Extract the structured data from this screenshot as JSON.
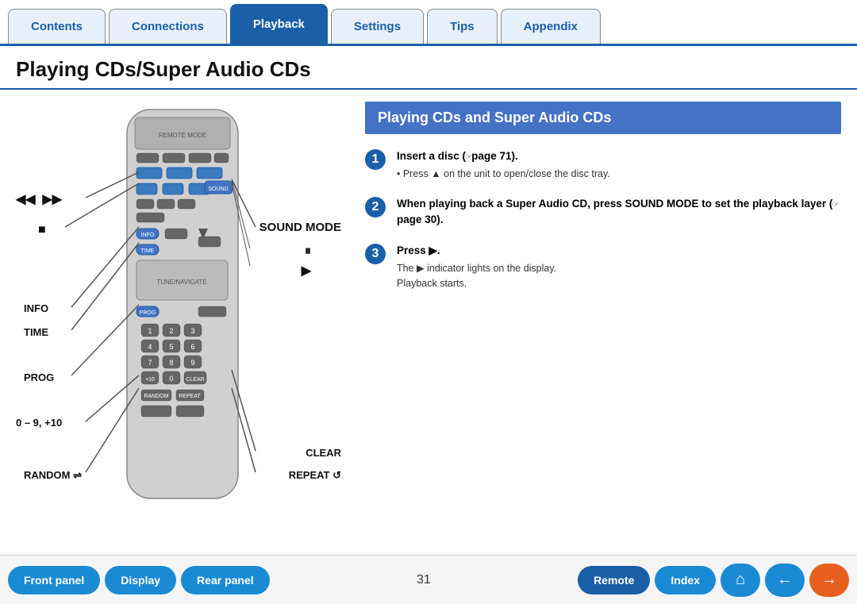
{
  "nav": {
    "tabs": [
      {
        "label": "Contents",
        "active": false
      },
      {
        "label": "Connections",
        "active": false
      },
      {
        "label": "Playback",
        "active": true
      },
      {
        "label": "Settings",
        "active": false
      },
      {
        "label": "Tips",
        "active": false
      },
      {
        "label": "Appendix",
        "active": false
      }
    ]
  },
  "page": {
    "title": "Playing CDs/Super Audio CDs",
    "section_header": "Playing CDs and Super Audio CDs"
  },
  "steps": [
    {
      "num": "1",
      "text_bold": "Insert a disc (☞page 71).",
      "sub": "• Press ▲ on the unit to open/close the disc tray."
    },
    {
      "num": "2",
      "text_bold": "When playing back a Super Audio CD, press SOUND MODE to set the playback layer (☞page 30).",
      "sub": ""
    },
    {
      "num": "3",
      "text_bold": "Press ▶.",
      "sub": "The ▶ indicator lights on the display.\nPlayback starts."
    }
  ],
  "labels": {
    "skip_back": "◀◀  ▶▶",
    "stop": "■",
    "sound_mode": "SOUND MODE",
    "pause": "⏸",
    "play": "▶",
    "info": "INFO",
    "time": "TIME",
    "prog": "PROG",
    "zero_nine": "0 – 9, +10",
    "clear": "CLEAR",
    "random": "RANDOM ⇌",
    "repeat": "REPEAT ↺"
  },
  "bottom": {
    "page_num": "31",
    "buttons": [
      {
        "label": "Front panel",
        "active": false
      },
      {
        "label": "Display",
        "active": false
      },
      {
        "label": "Rear panel",
        "active": false
      },
      {
        "label": "Remote",
        "active": true
      },
      {
        "label": "Index",
        "active": false
      }
    ],
    "icons": [
      "⌂",
      "←",
      "→"
    ]
  }
}
